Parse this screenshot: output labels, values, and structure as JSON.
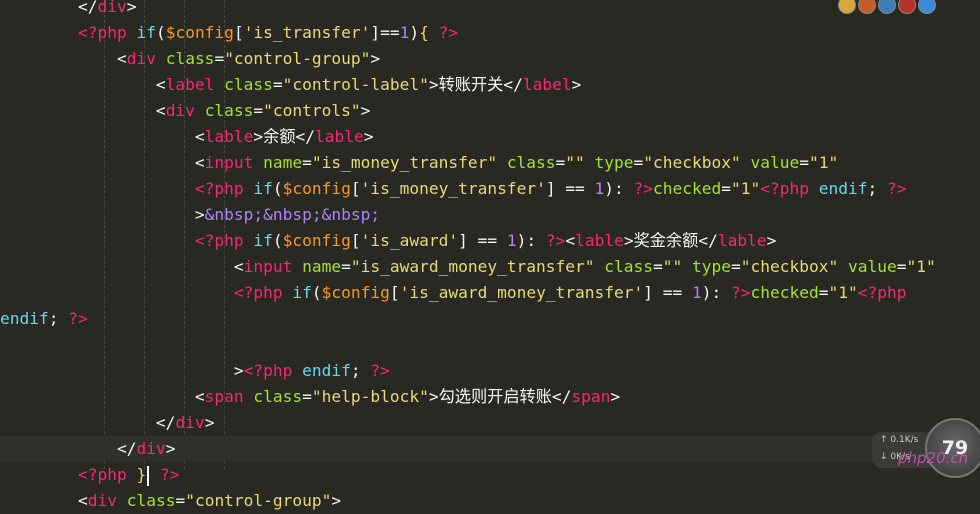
{
  "editor": {
    "lines": [
      [
        [
          "t-pun",
          "        </"
        ],
        [
          "t-tag",
          "div"
        ],
        [
          "t-pun",
          ">"
        ]
      ],
      [
        [
          "t-pun",
          "        "
        ],
        [
          "t-php",
          "<?php"
        ],
        [
          "t-pun",
          " "
        ],
        [
          "t-kw",
          "if"
        ],
        [
          "t-pun",
          "("
        ],
        [
          "t-var",
          "$config"
        ],
        [
          "t-pun",
          "["
        ],
        [
          "t-str",
          "'is_transfer'"
        ],
        [
          "t-pun",
          "]=="
        ],
        [
          "t-num",
          "1"
        ],
        [
          "t-pun",
          ")"
        ],
        [
          "t-brace",
          "{"
        ],
        [
          "t-pun",
          " "
        ],
        [
          "t-php",
          "?>"
        ]
      ],
      [
        [
          "t-pun",
          "            <"
        ],
        [
          "t-tag",
          "div"
        ],
        [
          "t-pun",
          " "
        ],
        [
          "t-attr",
          "class"
        ],
        [
          "t-pun",
          "="
        ],
        [
          "t-str",
          "\"control-group\""
        ],
        [
          "t-pun",
          ">"
        ]
      ],
      [
        [
          "t-pun",
          "                <"
        ],
        [
          "t-tag",
          "label"
        ],
        [
          "t-pun",
          " "
        ],
        [
          "t-attr",
          "class"
        ],
        [
          "t-pun",
          "="
        ],
        [
          "t-str",
          "\"control-label\""
        ],
        [
          "t-pun",
          ">"
        ],
        [
          "t-txt",
          "转账开关"
        ],
        [
          "t-pun",
          "</"
        ],
        [
          "t-tag",
          "label"
        ],
        [
          "t-pun",
          ">"
        ]
      ],
      [
        [
          "t-pun",
          "                <"
        ],
        [
          "t-tag",
          "div"
        ],
        [
          "t-pun",
          " "
        ],
        [
          "t-attr",
          "class"
        ],
        [
          "t-pun",
          "="
        ],
        [
          "t-str",
          "\"controls\""
        ],
        [
          "t-pun",
          ">"
        ]
      ],
      [
        [
          "t-pun",
          "                    <"
        ],
        [
          "t-tag",
          "lable"
        ],
        [
          "t-pun",
          ">"
        ],
        [
          "t-txt",
          "余额"
        ],
        [
          "t-pun",
          "</"
        ],
        [
          "t-tag",
          "lable"
        ],
        [
          "t-pun",
          ">"
        ]
      ],
      [
        [
          "t-pun",
          "                    <"
        ],
        [
          "t-tag",
          "input"
        ],
        [
          "t-pun",
          " "
        ],
        [
          "t-attr",
          "name"
        ],
        [
          "t-pun",
          "="
        ],
        [
          "t-str",
          "\"is_money_transfer\""
        ],
        [
          "t-pun",
          " "
        ],
        [
          "t-attr",
          "class"
        ],
        [
          "t-pun",
          "="
        ],
        [
          "t-str",
          "\"\""
        ],
        [
          "t-pun",
          " "
        ],
        [
          "t-attr",
          "type"
        ],
        [
          "t-pun",
          "="
        ],
        [
          "t-str",
          "\"checkbox\""
        ],
        [
          "t-pun",
          " "
        ],
        [
          "t-attr",
          "value"
        ],
        [
          "t-pun",
          "="
        ],
        [
          "t-str",
          "\"1\""
        ]
      ],
      [
        [
          "t-pun",
          "                    "
        ],
        [
          "t-php",
          "<?php"
        ],
        [
          "t-pun",
          " "
        ],
        [
          "t-kw",
          "if"
        ],
        [
          "t-pun",
          "("
        ],
        [
          "t-var",
          "$config"
        ],
        [
          "t-pun",
          "["
        ],
        [
          "t-str",
          "'is_money_transfer'"
        ],
        [
          "t-pun",
          "] == "
        ],
        [
          "t-num",
          "1"
        ],
        [
          "t-pun",
          "): "
        ],
        [
          "t-php",
          "?>"
        ],
        [
          "t-attr",
          "checked"
        ],
        [
          "t-pun",
          "="
        ],
        [
          "t-str",
          "\"1\""
        ],
        [
          "t-php",
          "<?php"
        ],
        [
          "t-pun",
          " "
        ],
        [
          "t-kw",
          "endif"
        ],
        [
          "t-pun",
          "; "
        ],
        [
          "t-php",
          "?>"
        ]
      ],
      [
        [
          "t-pun",
          "                    >"
        ],
        [
          "t-ent",
          "&nbsp;&nbsp;&nbsp;"
        ]
      ],
      [
        [
          "t-pun",
          "                    "
        ],
        [
          "t-php",
          "<?php"
        ],
        [
          "t-pun",
          " "
        ],
        [
          "t-kw",
          "if"
        ],
        [
          "t-pun",
          "("
        ],
        [
          "t-var",
          "$config"
        ],
        [
          "t-pun",
          "["
        ],
        [
          "t-str",
          "'is_award'"
        ],
        [
          "t-pun",
          "] == "
        ],
        [
          "t-num",
          "1"
        ],
        [
          "t-pun",
          "): "
        ],
        [
          "t-php",
          "?>"
        ],
        [
          "t-pun",
          "<"
        ],
        [
          "t-tag",
          "lable"
        ],
        [
          "t-pun",
          ">"
        ],
        [
          "t-txt",
          "奖金余额"
        ],
        [
          "t-pun",
          "</"
        ],
        [
          "t-tag",
          "lable"
        ],
        [
          "t-pun",
          ">"
        ]
      ],
      [
        [
          "t-pun",
          "                        <"
        ],
        [
          "t-tag",
          "input"
        ],
        [
          "t-pun",
          " "
        ],
        [
          "t-attr",
          "name"
        ],
        [
          "t-pun",
          "="
        ],
        [
          "t-str",
          "\"is_award_money_transfer\""
        ],
        [
          "t-pun",
          " "
        ],
        [
          "t-attr",
          "class"
        ],
        [
          "t-pun",
          "="
        ],
        [
          "t-str",
          "\"\""
        ],
        [
          "t-pun",
          " "
        ],
        [
          "t-attr",
          "type"
        ],
        [
          "t-pun",
          "="
        ],
        [
          "t-str",
          "\"checkbox\""
        ],
        [
          "t-pun",
          " "
        ],
        [
          "t-attr",
          "value"
        ],
        [
          "t-pun",
          "="
        ],
        [
          "t-str",
          "\"1\""
        ]
      ],
      [
        [
          "t-pun",
          "                        "
        ],
        [
          "t-php",
          "<?php"
        ],
        [
          "t-pun",
          " "
        ],
        [
          "t-kw",
          "if"
        ],
        [
          "t-pun",
          "("
        ],
        [
          "t-var",
          "$config"
        ],
        [
          "t-pun",
          "["
        ],
        [
          "t-str",
          "'is_award_money_transfer'"
        ],
        [
          "t-pun",
          "] == "
        ],
        [
          "t-num",
          "1"
        ],
        [
          "t-pun",
          "): "
        ],
        [
          "t-php",
          "?>"
        ],
        [
          "t-attr",
          "checked"
        ],
        [
          "t-pun",
          "="
        ],
        [
          "t-str",
          "\"1\""
        ],
        [
          "t-php",
          "<?php"
        ]
      ],
      [
        [
          "t-kw",
          "endif"
        ],
        [
          "t-pun",
          "; "
        ],
        [
          "t-php",
          "?>"
        ]
      ],
      [],
      [
        [
          "t-pun",
          "                        >"
        ],
        [
          "t-php",
          "<?php"
        ],
        [
          "t-pun",
          " "
        ],
        [
          "t-kw",
          "endif"
        ],
        [
          "t-pun",
          "; "
        ],
        [
          "t-php",
          "?>"
        ]
      ],
      [
        [
          "t-pun",
          "                    <"
        ],
        [
          "t-tag",
          "span"
        ],
        [
          "t-pun",
          " "
        ],
        [
          "t-attr",
          "class"
        ],
        [
          "t-pun",
          "="
        ],
        [
          "t-str",
          "\"help-block\""
        ],
        [
          "t-pun",
          ">"
        ],
        [
          "t-txt",
          "勾选则开启转账"
        ],
        [
          "t-pun",
          "</"
        ],
        [
          "t-tag",
          "span"
        ],
        [
          "t-pun",
          ">"
        ]
      ],
      [
        [
          "t-pun",
          "                </"
        ],
        [
          "t-tag",
          "div"
        ],
        [
          "t-pun",
          ">"
        ]
      ],
      [
        [
          "t-pun",
          "            </"
        ],
        [
          "t-tag",
          "div"
        ],
        [
          "t-pun",
          ">"
        ]
      ],
      [
        [
          "t-pun",
          "        "
        ],
        [
          "t-php",
          "<?php"
        ],
        [
          "t-pun",
          " "
        ],
        [
          "t-brace",
          "}"
        ],
        [
          "caret",
          ""
        ],
        [
          "t-pun",
          " "
        ],
        [
          "t-php",
          "?>"
        ]
      ],
      [
        [
          "t-pun",
          "        <"
        ],
        [
          "t-tag",
          "div"
        ],
        [
          "t-pun",
          " "
        ],
        [
          "t-attr",
          "class"
        ],
        [
          "t-pun",
          "="
        ],
        [
          "t-str",
          "\"control-group\""
        ],
        [
          "t-pun",
          ">"
        ]
      ]
    ],
    "current_line": 17
  },
  "overlay": {
    "speed_up": "0.1K/s",
    "speed_down": "0K/s",
    "gauge_value": "79",
    "watermark": "php20.cn"
  },
  "browser_icons": [
    {
      "name": "chrome-icon",
      "color": "#d9a83a"
    },
    {
      "name": "firefox-icon",
      "color": "#c75b2a"
    },
    {
      "name": "safari-icon",
      "color": "#3d7fb8"
    },
    {
      "name": "opera-icon",
      "color": "#b8302a"
    },
    {
      "name": "ie-icon",
      "color": "#3b8ad6"
    }
  ]
}
